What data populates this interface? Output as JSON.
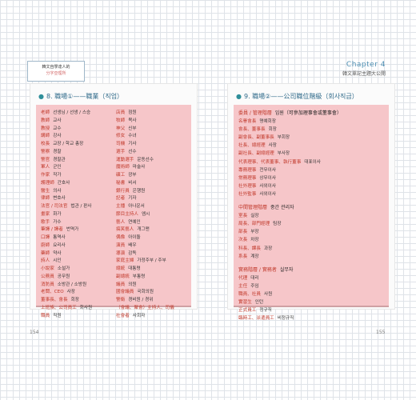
{
  "book_tag": {
    "line1": "韓文自學達人的",
    "line2": "分字亞理所"
  },
  "chapter": {
    "title": "Chapter 4",
    "subtitle": "韓文單記主題大公開"
  },
  "left": {
    "title": "8. 職場①——職業（직업）",
    "col1": [
      {
        "term": "老師",
        "ko": "선생님 / 선생 / 스승"
      },
      {
        "term": "教師",
        "ko": "교사"
      },
      {
        "term": "教授",
        "ko": "교수"
      },
      {
        "term": "講師",
        "ko": "강사"
      },
      {
        "term": "校長",
        "ko": "교장 / 학교 총장"
      },
      {
        "term": "警察",
        "ko": "경찰"
      },
      {
        "term": "警官",
        "ko": "경찰관"
      },
      {
        "term": "軍人",
        "ko": "군인"
      },
      {
        "term": "作家",
        "ko": "작가"
      },
      {
        "term": "護理師",
        "ko": "간호사"
      },
      {
        "term": "醫生",
        "ko": "의사"
      },
      {
        "term": "律師",
        "ko": "변호사"
      },
      {
        "term": "法官 / 司法官",
        "ko": "법관 / 판사"
      },
      {
        "term": "畫家",
        "ko": "화가"
      },
      {
        "term": "歌手",
        "ko": "가수"
      },
      {
        "term": "筆譯 / 譯者",
        "ko": "번역가"
      },
      {
        "term": "口譯",
        "ko": "통역사"
      },
      {
        "term": "廚師",
        "ko": "요리사"
      },
      {
        "term": "藥師",
        "ko": "약사"
      },
      {
        "term": "詩人",
        "ko": "시인"
      },
      {
        "term": "小說家",
        "ko": "소설가"
      },
      {
        "term": "公務員",
        "ko": "공무원"
      },
      {
        "term": "消防員",
        "ko": "소방관 / 소방원"
      },
      {
        "term": "老闆、CEO",
        "ko": "사장"
      },
      {
        "term": "董事長、會長",
        "ko": "회장"
      },
      {
        "term": "上班族、公司員工",
        "ko": "회사원"
      },
      {
        "term": "職員",
        "ko": "직원"
      }
    ],
    "col2": [
      {
        "term": "店員",
        "ko": "점원"
      },
      {
        "term": "牧師",
        "ko": "목사"
      },
      {
        "term": "神父",
        "ko": "신부"
      },
      {
        "term": "修女",
        "ko": "수녀"
      },
      {
        "term": "司機",
        "ko": "기사"
      },
      {
        "term": "選手",
        "ko": "선수"
      },
      {
        "term": "運動選手",
        "ko": "운동선수"
      },
      {
        "term": "魔術師",
        "ko": "마술사"
      },
      {
        "term": "礦工",
        "ko": "광부"
      },
      {
        "term": "秘書",
        "ko": "비서"
      },
      {
        "term": "銀行員",
        "ko": "은행원"
      },
      {
        "term": "記者",
        "ko": "기자"
      },
      {
        "term": "主播",
        "ko": "아나운서"
      },
      {
        "term": "節目主持人",
        "ko": "엠시"
      },
      {
        "term": "藝人",
        "ko": "연예인"
      },
      {
        "term": "搞笑藝人",
        "ko": "개그맨"
      },
      {
        "term": "偶像",
        "ko": "아이돌"
      },
      {
        "term": "演員",
        "ko": "배우"
      },
      {
        "term": "導演",
        "ko": "감독"
      },
      {
        "term": "家庭主婦",
        "ko": "가정주부 / 주부"
      },
      {
        "term": "總統",
        "ko": "대통령"
      },
      {
        "term": "副總統",
        "ko": "부통령"
      },
      {
        "term": "議員",
        "ko": "의원"
      },
      {
        "term": "國會議員",
        "ko": "국회의원"
      },
      {
        "term": "警衛",
        "ko": "경비원 / 경위"
      },
      {
        "term": "（會議、聚會）主持人、司儀",
        "ko": ""
      },
      {
        "term": "社會者",
        "ko": "사회자"
      }
    ]
  },
  "right": {
    "title": "9. 職場②——公司職位階級（회사직급）",
    "groups": [
      {
        "head": "委員 / 管理階層",
        "head_ko": "임원（可參加理事會或董事會）",
        "rows": [
          {
            "term": "名譽會長",
            "ko": "명예회장"
          },
          {
            "term": "會長、董事長",
            "ko": "회장"
          },
          {
            "term": "副會長、副董事長",
            "ko": "부회장"
          },
          {
            "term": "社長、總經理",
            "ko": "사장"
          },
          {
            "term": "副社長、副總經理",
            "ko": "부사장"
          },
          {
            "term": "代表理事、代表董事、執行董事",
            "ko": "대표이사"
          },
          {
            "term": "專務理事",
            "ko": "전무이사"
          },
          {
            "term": "常務理事",
            "ko": "상무이사"
          },
          {
            "term": "社外理事",
            "ko": "사외이사"
          },
          {
            "term": "社外監事",
            "ko": "사외이사"
          }
        ]
      },
      {
        "head": "中間管理階層",
        "head_ko": "중간 관리자",
        "rows": [
          {
            "term": "室長",
            "ko": "실장"
          },
          {
            "term": "局長、部門經理",
            "ko": "팀장"
          },
          {
            "term": "部長",
            "ko": "부장"
          },
          {
            "term": "次長",
            "ko": "차장"
          },
          {
            "term": "科長、課長",
            "ko": "과장"
          },
          {
            "term": "系長",
            "ko": "계장"
          }
        ]
      },
      {
        "head": "實務階層 / 實務者",
        "head_ko": "실무자",
        "rows": [
          {
            "term": "代理",
            "ko": "대리"
          },
          {
            "term": "主任",
            "ko": "주임"
          },
          {
            "term": "職員、社員",
            "ko": "사원"
          },
          {
            "term": "實習生",
            "ko": "인턴"
          },
          {
            "term": "正式員工",
            "ko": "정규직"
          },
          {
            "term": "臨時工、派遣員工",
            "ko": "비정규직"
          }
        ]
      }
    ]
  },
  "page_left": "154",
  "page_right": "155"
}
